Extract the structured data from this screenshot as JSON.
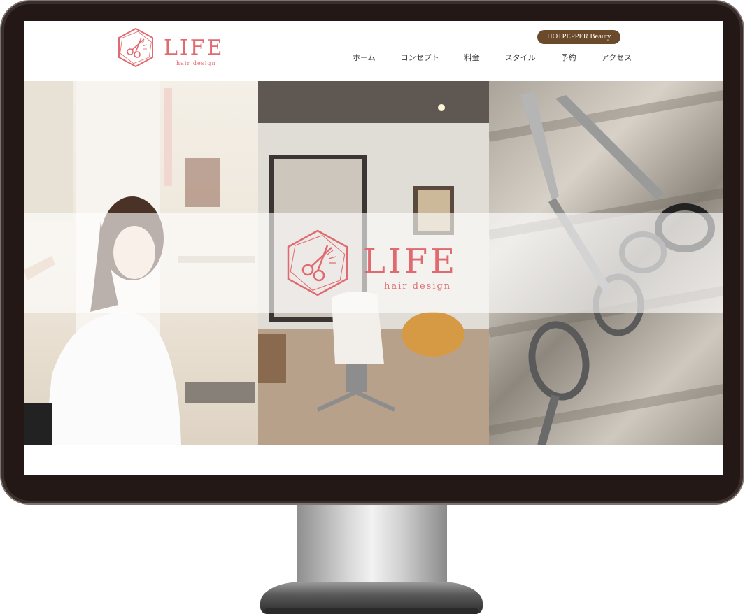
{
  "header": {
    "logo": {
      "title": "LIFE",
      "subtitle": "hair design"
    },
    "hotpepper_label": "HOTPEPPER Beauty",
    "nav": [
      {
        "label": "ホーム"
      },
      {
        "label": "コンセプト"
      },
      {
        "label": "料金"
      },
      {
        "label": "スタイル"
      },
      {
        "label": "予約"
      },
      {
        "label": "アクセス"
      }
    ]
  },
  "hero": {
    "logo": {
      "title": "LIFE",
      "subtitle": "hair design"
    },
    "panels": [
      {
        "icon": "salon-client-photo"
      },
      {
        "icon": "salon-interior-photo"
      },
      {
        "icon": "scissors-photo"
      }
    ]
  },
  "colors": {
    "brand_pink": "#e06a6f",
    "hotpepper_brown": "#6b4a2b",
    "monitor_frame": "#231815"
  }
}
